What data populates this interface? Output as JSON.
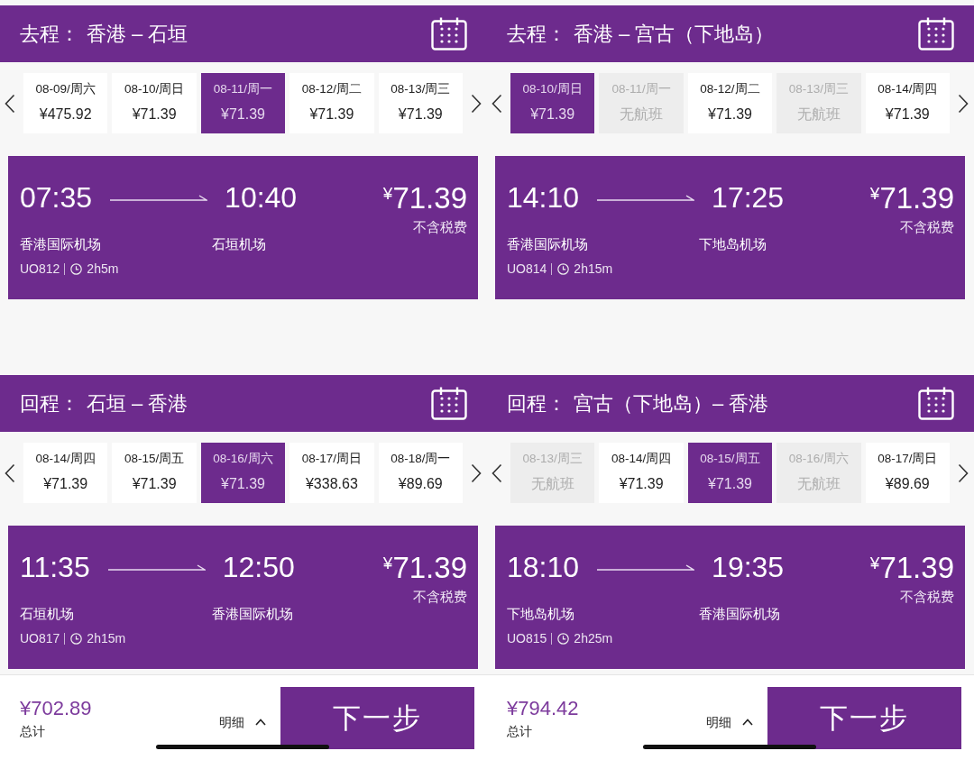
{
  "screens": [
    {
      "legs": [
        {
          "direction": "去程：",
          "route": "香港 – 石垣",
          "dates": [
            {
              "date": "08-09/周六",
              "fare": "¥475.92",
              "selected": false,
              "available": true
            },
            {
              "date": "08-10/周日",
              "fare": "¥71.39",
              "selected": false,
              "available": true
            },
            {
              "date": "08-11/周一",
              "fare": "¥71.39",
              "selected": true,
              "available": true
            },
            {
              "date": "08-12/周二",
              "fare": "¥71.39",
              "selected": false,
              "available": true
            },
            {
              "date": "08-13/周三",
              "fare": "¥71.39",
              "selected": false,
              "available": true
            }
          ],
          "flight": {
            "departure_time": "07:35",
            "arrival_time": "10:40",
            "price": "¥71.39",
            "price_note": "不含税费",
            "departure_airport": "香港国际机场",
            "arrival_airport": "石垣机场",
            "flight_number": "UO812",
            "duration": "2h5m"
          }
        },
        {
          "direction": "回程：",
          "route": "石垣 – 香港",
          "dates": [
            {
              "date": "08-14/周四",
              "fare": "¥71.39",
              "selected": false,
              "available": true
            },
            {
              "date": "08-15/周五",
              "fare": "¥71.39",
              "selected": false,
              "available": true
            },
            {
              "date": "08-16/周六",
              "fare": "¥71.39",
              "selected": true,
              "available": true
            },
            {
              "date": "08-17/周日",
              "fare": "¥338.63",
              "selected": false,
              "available": true
            },
            {
              "date": "08-18/周一",
              "fare": "¥89.69",
              "selected": false,
              "available": true
            }
          ],
          "flight": {
            "departure_time": "11:35",
            "arrival_time": "12:50",
            "price": "¥71.39",
            "price_note": "不含税费",
            "departure_airport": "石垣机场",
            "arrival_airport": "香港国际机场",
            "flight_number": "UO817",
            "duration": "2h15m"
          }
        }
      ],
      "footer": {
        "total": "¥702.89",
        "total_label": "总计",
        "details": "明细",
        "next_button": "下一步"
      }
    },
    {
      "legs": [
        {
          "direction": "去程：",
          "route": "香港 – 宫古（下地岛）",
          "dates": [
            {
              "date": "08-10/周日",
              "fare": "¥71.39",
              "selected": true,
              "available": true
            },
            {
              "date": "08-11/周一",
              "fare": "无航班",
              "selected": false,
              "available": false
            },
            {
              "date": "08-12/周二",
              "fare": "¥71.39",
              "selected": false,
              "available": true
            },
            {
              "date": "08-13/周三",
              "fare": "无航班",
              "selected": false,
              "available": false
            },
            {
              "date": "08-14/周四",
              "fare": "¥71.39",
              "selected": false,
              "available": true
            }
          ],
          "flight": {
            "departure_time": "14:10",
            "arrival_time": "17:25",
            "price": "¥71.39",
            "price_note": "不含税费",
            "departure_airport": "香港国际机场",
            "arrival_airport": "下地岛机场",
            "flight_number": "UO814",
            "duration": "2h15m"
          }
        },
        {
          "direction": "回程：",
          "route": "宫古（下地岛）– 香港",
          "dates": [
            {
              "date": "08-13/周三",
              "fare": "无航班",
              "selected": false,
              "available": false
            },
            {
              "date": "08-14/周四",
              "fare": "¥71.39",
              "selected": false,
              "available": true
            },
            {
              "date": "08-15/周五",
              "fare": "¥71.39",
              "selected": true,
              "available": true
            },
            {
              "date": "08-16/周六",
              "fare": "无航班",
              "selected": false,
              "available": false
            },
            {
              "date": "08-17/周日",
              "fare": "¥89.69",
              "selected": false,
              "available": true
            }
          ],
          "flight": {
            "departure_time": "18:10",
            "arrival_time": "19:35",
            "price": "¥71.39",
            "price_note": "不含税费",
            "departure_airport": "下地岛机场",
            "arrival_airport": "香港国际机场",
            "flight_number": "UO815",
            "duration": "2h25m"
          }
        }
      ],
      "footer": {
        "total": "¥794.42",
        "total_label": "总计",
        "details": "明细",
        "next_button": "下一步"
      }
    }
  ]
}
